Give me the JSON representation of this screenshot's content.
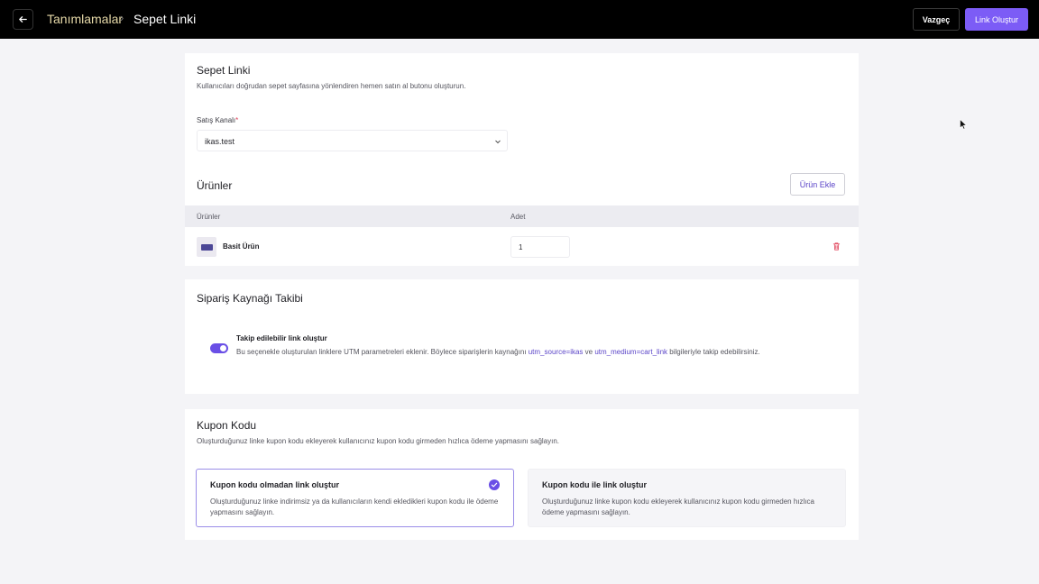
{
  "header": {
    "breadcrumb_parent": "Tanımlamalar",
    "breadcrumb_separator": "›",
    "breadcrumb_current": "Sepet Linki",
    "cancel_label": "Vazgeç",
    "create_label": "Link Oluştur"
  },
  "sepet_linki": {
    "title": "Sepet Linki",
    "description": "Kullanıcıları doğrudan sepet sayfasına yönlendiren hemen satın al butonu oluşturun.",
    "channel_label": "Satış Kanalı",
    "required_mark": "*",
    "channel_value": "ikas.test"
  },
  "products": {
    "title": "Ürünler",
    "add_label": "Ürün Ekle",
    "columns": [
      "Ürünler",
      "Adet"
    ],
    "rows": [
      {
        "name": "Basit Ürün",
        "quantity": "1"
      }
    ]
  },
  "tracking": {
    "title": "Sipariş Kaynağı Takibi",
    "toggle_on": true,
    "toggle_title": "Takip edilebilir link oluştur",
    "desc_part1": "Bu seçenekle oluşturulan linklere UTM parametreleri eklenir. Böylece siparişlerin kaynağını ",
    "utm_source": "utm_source=ikas",
    "desc_part2": " ve ",
    "utm_medium": "utm_medium=cart_link",
    "desc_part3": " bilgileriyle takip edebilirsiniz."
  },
  "coupon": {
    "title": "Kupon Kodu",
    "description": "Oluşturduğunuz linke kupon kodu ekleyerek kullanıcınız kupon kodu girmeden hızlıca ödeme yapmasını sağlayın.",
    "options": [
      {
        "title": "Kupon kodu olmadan link oluştur",
        "description": "Oluşturduğunuz linke indirimsiz ya da kullanıcıların kendi ekledikleri kupon kodu ile ödeme yapmasını sağlayın.",
        "selected": true
      },
      {
        "title": "Kupon kodu ile link oluştur",
        "description": "Oluşturduğunuz linke kupon kodu ekleyerek kullanıcınız kupon kodu girmeden hızlıca ödeme yapmasını sağlayın.",
        "selected": false
      }
    ]
  },
  "colors": {
    "accent": "#7c5cf6",
    "topbar": "#000000",
    "breadcrumb_parent": "#e6d9a8",
    "delete": "#e0435a"
  },
  "icons": [
    "arrow-left-icon",
    "chevron-right-icon",
    "chevron-down-icon",
    "trash-icon",
    "check-circle-icon",
    "mouse-pointer-icon"
  ]
}
